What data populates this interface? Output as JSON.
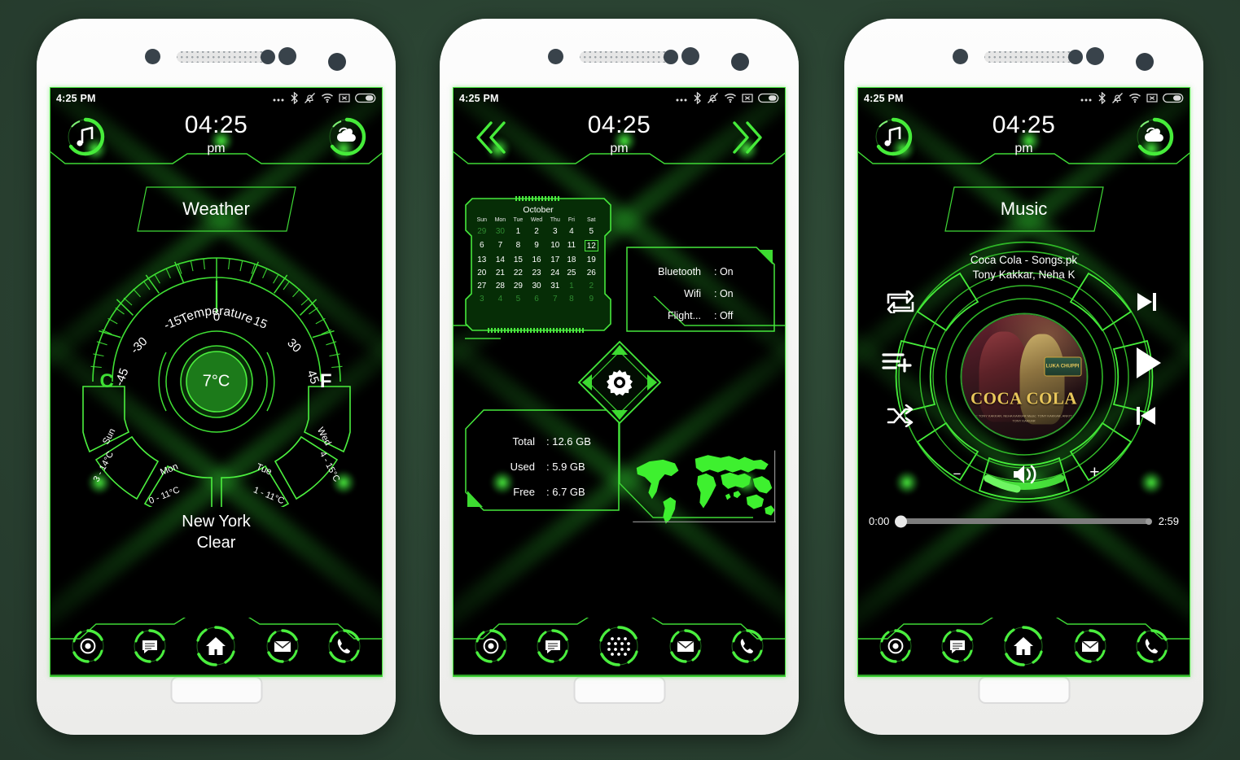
{
  "status_bar": {
    "time": "4:25 PM",
    "icons": [
      "more-dots-icon",
      "bluetooth-icon",
      "mute-bell-icon",
      "wifi-icon",
      "sim-x-icon",
      "battery-icon"
    ]
  },
  "header": {
    "clock": "04:25",
    "ampm": "pm",
    "left_icon": "music-note-icon",
    "right_icon": "weather-cloud-sun-icon",
    "prev_icon": "chevron-double-left-icon",
    "next_icon": "chevron-double-right-icon"
  },
  "screens": {
    "weather": {
      "title": "Weather",
      "gauge": {
        "label": "Temperature",
        "ticks": [
          "-45",
          "-30",
          "-15",
          "0",
          "15",
          "30",
          "45"
        ],
        "value": "7°C",
        "needle_value": 0
      },
      "unit_c": "C",
      "unit_f": "F",
      "forecast": [
        {
          "day": "Sun",
          "range": "3 - 14°C"
        },
        {
          "day": "Mon",
          "range": "0 - 11°C"
        },
        {
          "day": "Tue",
          "range": "1 - 11°C"
        },
        {
          "day": "Wed",
          "range": "4 - 15°C"
        }
      ],
      "location": "New York",
      "condition": "Clear"
    },
    "tools": {
      "calendar": {
        "month": "October",
        "weekdays": [
          "Sun",
          "Mon",
          "Tue",
          "Wed",
          "Thu",
          "Fri",
          "Sat"
        ],
        "today": "12",
        "weeks": [
          [
            {
              "d": "29",
              "dim": true
            },
            {
              "d": "30",
              "dim": true
            },
            {
              "d": "1"
            },
            {
              "d": "2"
            },
            {
              "d": "3"
            },
            {
              "d": "4"
            },
            {
              "d": "5"
            }
          ],
          [
            {
              "d": "6"
            },
            {
              "d": "7"
            },
            {
              "d": "8"
            },
            {
              "d": "9"
            },
            {
              "d": "10"
            },
            {
              "d": "11"
            },
            {
              "d": "12",
              "today": true
            }
          ],
          [
            {
              "d": "13"
            },
            {
              "d": "14"
            },
            {
              "d": "15"
            },
            {
              "d": "16"
            },
            {
              "d": "17"
            },
            {
              "d": "18"
            },
            {
              "d": "19"
            }
          ],
          [
            {
              "d": "20"
            },
            {
              "d": "21"
            },
            {
              "d": "22"
            },
            {
              "d": "23"
            },
            {
              "d": "24"
            },
            {
              "d": "25"
            },
            {
              "d": "26"
            }
          ],
          [
            {
              "d": "27"
            },
            {
              "d": "28"
            },
            {
              "d": "29"
            },
            {
              "d": "30"
            },
            {
              "d": "31"
            },
            {
              "d": "1",
              "dim": true
            },
            {
              "d": "2",
              "dim": true
            }
          ],
          [
            {
              "d": "3",
              "dim": true
            },
            {
              "d": "4",
              "dim": true
            },
            {
              "d": "5",
              "dim": true
            },
            {
              "d": "6",
              "dim": true
            },
            {
              "d": "7",
              "dim": true
            },
            {
              "d": "8",
              "dim": true
            },
            {
              "d": "9",
              "dim": true
            }
          ]
        ]
      },
      "toggles": [
        {
          "label": "Bluetooth",
          "value": ": On"
        },
        {
          "label": "Wifi",
          "value": ": On"
        },
        {
          "label": "Flight...",
          "value": ": Off"
        }
      ],
      "settings_icon": "gear-icon",
      "storage": [
        {
          "label": "Total",
          "value": ": 12.6 GB"
        },
        {
          "label": "Used",
          "value": ": 5.9 GB"
        },
        {
          "label": "Free",
          "value": ": 6.7 GB"
        }
      ],
      "map_icon": "world-map-icon"
    },
    "music": {
      "title": "Music",
      "track_title": "Coca Cola - Songs.pk",
      "track_artist": "Tony Kakkar, Neha K",
      "album_title": "COCA COLA",
      "album_badge": "LUKA CHUPPI",
      "album_credit": "Singers: TONY KAKKAR, NEHA KAKKAR\nMusic: TONY KAKKAR, ANKIT\nLyrics: TONY KAKKAR",
      "controls": {
        "repeat": "repeat-icon",
        "playlist_add": "playlist-add-icon",
        "shuffle": "shuffle-icon",
        "next": "next-track-icon",
        "play": "play-icon",
        "previous": "previous-track-icon",
        "volume": "volume-icon",
        "vol_down": "−",
        "vol_up": "+"
      },
      "seek": {
        "elapsed": "0:00",
        "duration": "2:59",
        "progress_percent": 0
      }
    }
  },
  "dock": {
    "left": [
      {
        "name": "chrome-icon"
      },
      {
        "name": "messages-icon"
      }
    ],
    "center_home": {
      "name": "home-icon"
    },
    "center_drawer": {
      "name": "app-drawer-icon"
    },
    "right": [
      {
        "name": "mail-icon"
      },
      {
        "name": "phone-icon"
      }
    ]
  },
  "colors": {
    "accent_green": "#3ee034",
    "bright_green": "#4aee3e",
    "screen_bg": "#000000",
    "page_bg": "#2b4433"
  }
}
